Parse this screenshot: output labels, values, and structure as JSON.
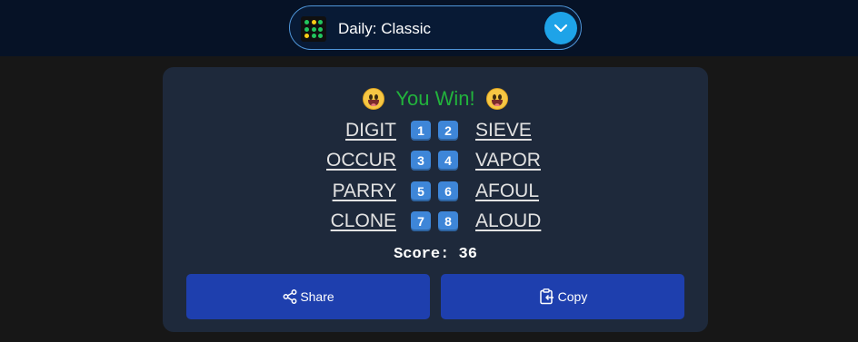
{
  "header": {
    "mode_label": "Daily: Classic",
    "accent_color": "#1ea3e8",
    "logo_dot_colors": [
      "#22c55e",
      "#facc15",
      "#22c55e",
      "#22c55e",
      "#22c55e",
      "#22c55e",
      "#facc15",
      "#22c55e",
      "#22c55e"
    ]
  },
  "result": {
    "title": "You Win!",
    "title_color": "#22b33c",
    "emoji": "grinning-face",
    "pairs": [
      {
        "left": "DIGIT",
        "badge_a": "1",
        "badge_b": "2",
        "right": "SIEVE"
      },
      {
        "left": "OCCUR",
        "badge_a": "3",
        "badge_b": "4",
        "right": "VAPOR"
      },
      {
        "left": "PARRY",
        "badge_a": "5",
        "badge_b": "6",
        "right": "AFOUL"
      },
      {
        "left": "CLONE",
        "badge_a": "7",
        "badge_b": "8",
        "right": "ALOUD"
      }
    ],
    "score_label": "Score: 36"
  },
  "actions": {
    "share_label": "Share",
    "copy_label": "Copy",
    "share_icon": "share-icon",
    "copy_icon": "clipboard-copy-icon"
  }
}
